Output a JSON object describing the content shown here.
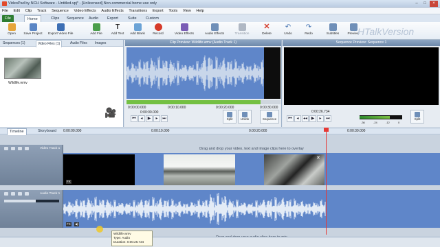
{
  "window": {
    "title": "VideoPad by NCH Software - Untitled.vpj* - [Unlicensed] Non-commercial home use only"
  },
  "menu": [
    "File",
    "Edit",
    "Clip",
    "Track",
    "Sequence",
    "Video Effects",
    "Audio Effects",
    "Transitions",
    "Export",
    "Tools",
    "View",
    "Help"
  ],
  "ribbon_tabs": [
    "File",
    "Home",
    "Clips",
    "Sequence",
    "Audio",
    "Export",
    "Suite",
    "Custom"
  ],
  "ribbon_buttons": [
    {
      "label": "Open",
      "color": "#e6a53a"
    },
    {
      "label": "Save Project",
      "color": "#5b86c5"
    },
    {
      "label": "Export Video File",
      "color": "#3d6fb4"
    },
    {
      "label": "Add File",
      "color": "#4b9e4b"
    },
    {
      "label": "Add Text",
      "color": "#222222"
    },
    {
      "label": "Add Blank",
      "color": "#6ba3d6"
    },
    {
      "label": "Record",
      "color": "#d63b2a"
    },
    {
      "label": "Video Effects",
      "color": "#7a5cb5"
    },
    {
      "label": "Audio Effects",
      "color": "#6f8fb8"
    },
    {
      "label": "Transition",
      "color": "#b0b8c4"
    },
    {
      "label": "Delete",
      "color": "#d43a2a"
    },
    {
      "label": "Undo",
      "color": "#3f6fb0"
    },
    {
      "label": "Redo",
      "color": "#3f6fb0"
    },
    {
      "label": "Subtitles",
      "color": "#6f8fb8"
    },
    {
      "label": "Preview",
      "color": "#6f8fb8"
    }
  ],
  "watermark": "HTalkVersion",
  "media_tabs": [
    "Sequences (1)",
    "Video Files (1)",
    "Audio Files",
    "Images"
  ],
  "media_file": {
    "name": "Wildlife.wmv"
  },
  "clip_preview": {
    "title": "Clip Preview: Wildlife.wmv (Audio Track 1)",
    "time_labels": [
      "0:00:00.000",
      "0:00:10.000",
      "0:00:20.000",
      "0:00:30.000"
    ],
    "current_time": "0:00:00.000",
    "progress": 0.87,
    "buttons": [
      "Split",
      "Unlink",
      "Sequence"
    ]
  },
  "sequence_preview": {
    "title": "Sequence Preview: Sequence 1",
    "current_time": "0:00:26.734",
    "vu_labels": [
      "-36",
      "-24",
      "-12",
      "0"
    ],
    "buttons": [
      "Split"
    ]
  },
  "timeline": {
    "tabs": [
      "Timeline",
      "Storyboard"
    ],
    "ticks": [
      "0:00:00.000",
      "0:00:10.000",
      "0:00:20.000",
      "0:00:30.000"
    ],
    "video_track": "Video Track 1",
    "audio_track": "Audio Track 1",
    "video_hint": "Drag and drop your video, text and image clips here to overlay",
    "audio_hint": "Drag and drop your audio clips here to mix"
  },
  "tooltip": {
    "line1": "Wildlife.wmv",
    "line2": "Type: Audio",
    "line3": "Duration: 0:00:26.734"
  }
}
